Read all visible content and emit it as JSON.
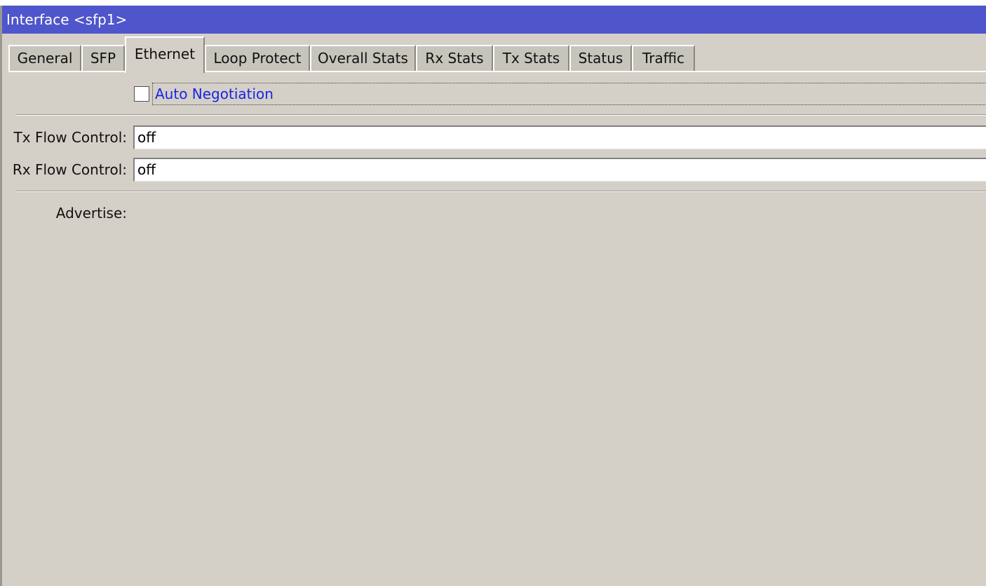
{
  "window": {
    "title": "Interface <sfp1>"
  },
  "tabs": [
    {
      "label": "General"
    },
    {
      "label": "SFP"
    },
    {
      "label": "Ethernet",
      "active": true
    },
    {
      "label": "Loop Protect"
    },
    {
      "label": "Overall Stats"
    },
    {
      "label": "Rx Stats"
    },
    {
      "label": "Tx Stats"
    },
    {
      "label": "Status"
    },
    {
      "label": "Traffic"
    }
  ],
  "ethernet": {
    "auto_negotiation": {
      "label": "Auto Negotiation",
      "checked": false
    },
    "tx_flow_control": {
      "label": "Tx Flow Control:",
      "value": "off"
    },
    "rx_flow_control": {
      "label": "Rx Flow Control:",
      "value": "off"
    },
    "advertise": {
      "label": "Advertise:"
    }
  },
  "colors": {
    "titlebar": "#4f55cb",
    "panel": "#d4d0c8",
    "link_text": "#1a24e6"
  }
}
